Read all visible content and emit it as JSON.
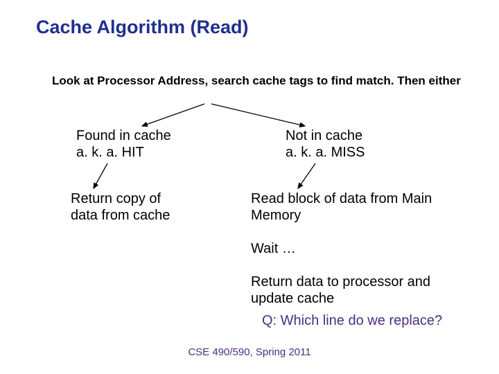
{
  "title": "Cache Algorithm (Read)",
  "intro": "Look at Processor Address, search cache tags to find match.  Then either",
  "left": {
    "head_l1": "Found in cache",
    "head_l2": "a. k. a.  HIT",
    "result": "Return copy of data from cache"
  },
  "right": {
    "head_l1": "Not in cache",
    "head_l2": "a. k. a.  MISS",
    "step1": "Read block of data from Main Memory",
    "step2": "Wait …",
    "step3": "Return data to processor and update cache"
  },
  "question": "Q: Which line do we replace?",
  "footer": "CSE 490/590, Spring 2011"
}
